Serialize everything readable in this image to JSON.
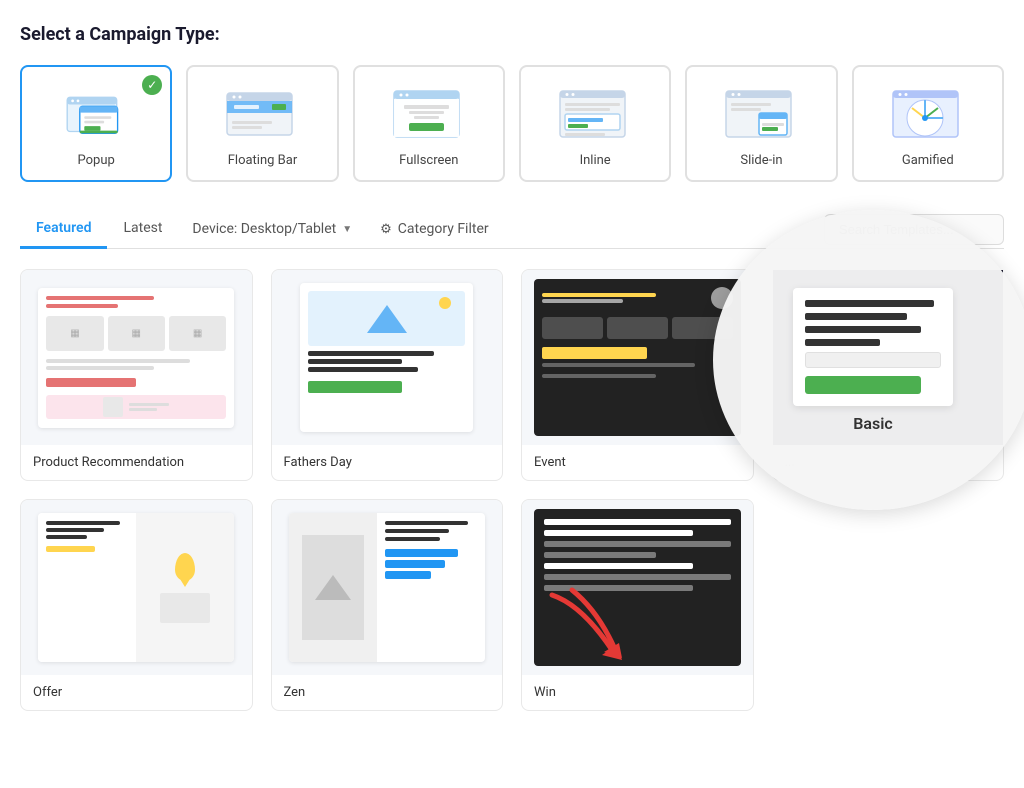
{
  "page": {
    "section_title": "Select a Campaign Type:"
  },
  "campaign_types": [
    {
      "id": "popup",
      "label": "Popup",
      "selected": true
    },
    {
      "id": "floating-bar",
      "label": "Floating Bar",
      "selected": false
    },
    {
      "id": "fullscreen",
      "label": "Fullscreen",
      "selected": false
    },
    {
      "id": "inline",
      "label": "Inline",
      "selected": false
    },
    {
      "id": "slide-in",
      "label": "Slide-in",
      "selected": false
    },
    {
      "id": "gamified",
      "label": "Gamified",
      "selected": false
    }
  ],
  "filter_bar": {
    "tabs": [
      {
        "id": "featured",
        "label": "Featured",
        "active": true
      },
      {
        "id": "latest",
        "label": "Latest",
        "active": false
      }
    ],
    "device_label": "Device: Desktop/Tablet",
    "category_label": "Category Filter",
    "search_placeholder": "Search Templates..."
  },
  "templates": [
    {
      "id": "product-recommendation",
      "name": "Product Recommendation",
      "type": "product"
    },
    {
      "id": "fathers-day",
      "name": "Fathers Day",
      "type": "fathers"
    },
    {
      "id": "event",
      "name": "Event",
      "type": "event"
    },
    {
      "id": "basic-zoom",
      "name": "Basic",
      "type": "basic-zoom"
    },
    {
      "id": "offer",
      "name": "Offer",
      "type": "offer"
    },
    {
      "id": "zen",
      "name": "Zen",
      "type": "zen"
    },
    {
      "id": "win",
      "name": "Win",
      "type": "win"
    }
  ]
}
